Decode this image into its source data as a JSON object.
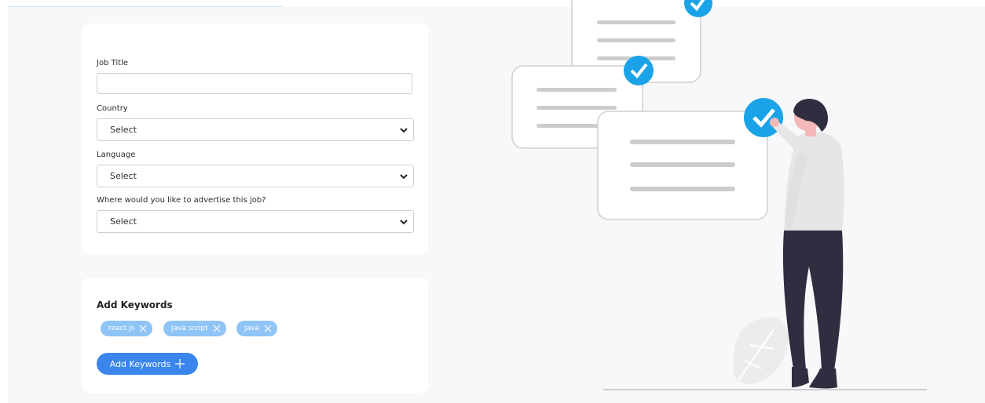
{
  "form": {
    "job_title_label": "Job Title",
    "job_title_value": "",
    "country_label": "Country",
    "country_value": "Select",
    "language_label": "Language",
    "language_value": "Select",
    "advertise_label": "Where would you like to advertise this job?",
    "advertise_value": "Select"
  },
  "keywords": {
    "title": "Add Keywords",
    "chips": [
      {
        "label": "react js"
      },
      {
        "label": "java script"
      },
      {
        "label": "java"
      }
    ],
    "add_button_label": "Add Keywords"
  },
  "colors": {
    "accent": "#3a86ec",
    "chip": "#8fc4f6",
    "check": "#1aa3e8",
    "background": "#f7f8fa"
  },
  "icons": {
    "chevron": "chevron-down-icon",
    "chip_remove": "close-icon",
    "add": "plus-icon",
    "illustration_check": "checkmark-icon"
  }
}
